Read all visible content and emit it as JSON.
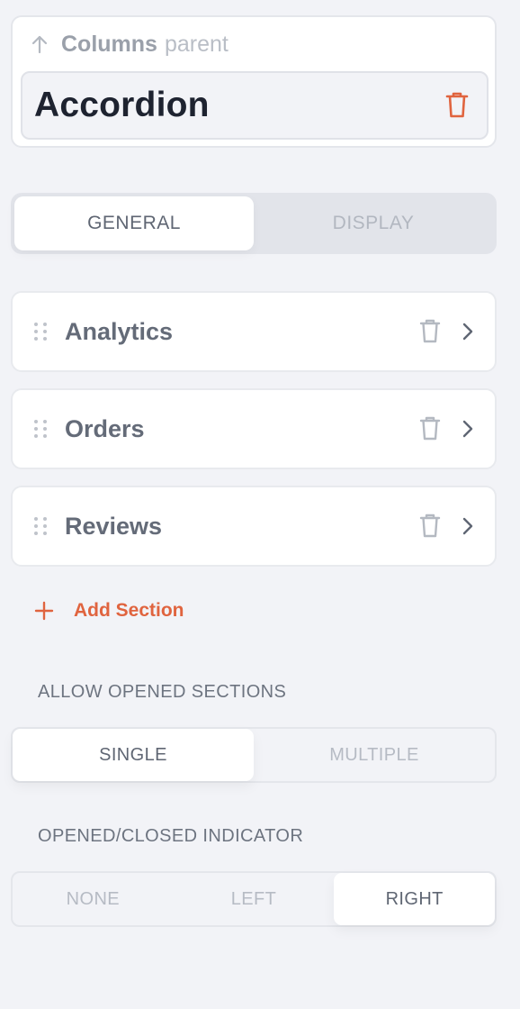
{
  "header": {
    "parent_name": "Columns",
    "parent_suffix": "parent",
    "title": "Accordion"
  },
  "tabs": [
    {
      "label": "GENERAL",
      "active": true
    },
    {
      "label": "DISPLAY",
      "active": false
    }
  ],
  "sections": [
    {
      "label": "Analytics"
    },
    {
      "label": "Orders"
    },
    {
      "label": "Reviews"
    }
  ],
  "add_section": {
    "label": "Add Section"
  },
  "allow_opened": {
    "label": "ALLOW OPENED SECTIONS",
    "options": [
      "SINGLE",
      "MULTIPLE"
    ],
    "selected": "SINGLE"
  },
  "indicator": {
    "label": "OPENED/CLOSED INDICATOR",
    "options": [
      "NONE",
      "LEFT",
      "RIGHT"
    ],
    "selected": "RIGHT"
  },
  "icons": {
    "parent": "arrow-up-icon",
    "delete": "trash-icon",
    "drag": "drag-handle-icon",
    "expand": "chevron-right-icon",
    "add": "plus-icon"
  },
  "colors": {
    "accent": "#e0643f",
    "background": "#f2f3f7",
    "text": "#5f6673"
  }
}
